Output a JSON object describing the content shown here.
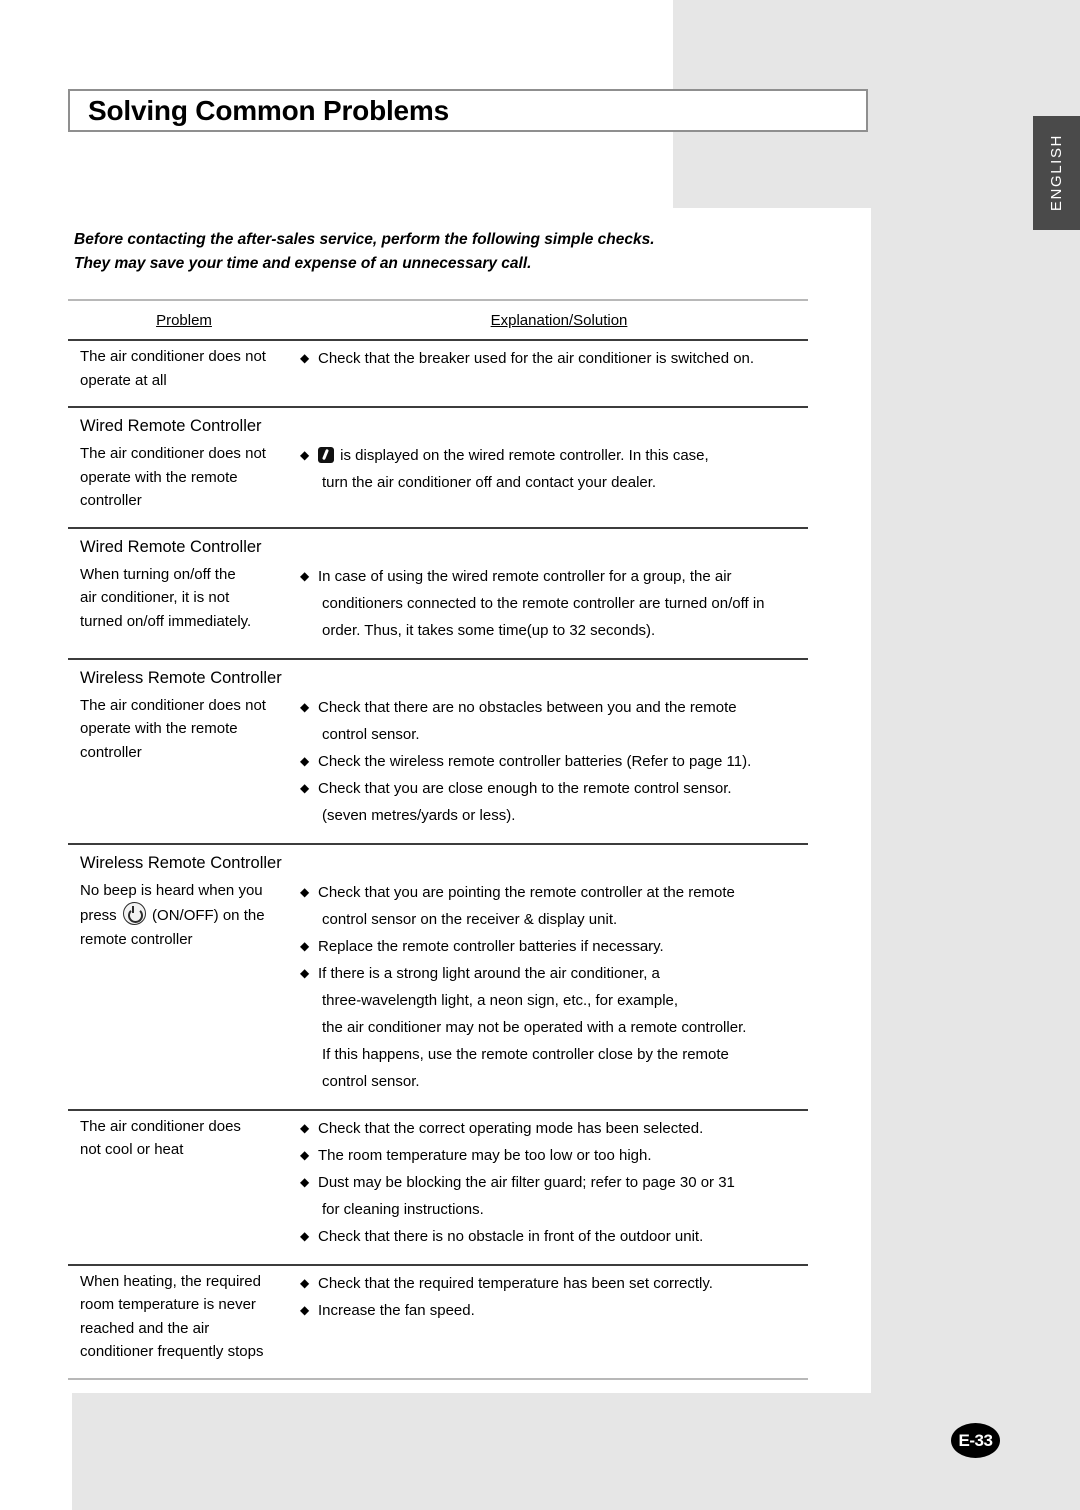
{
  "page": {
    "title": "Solving Common Problems",
    "language_tab": "ENGLISH",
    "page_number": "E-33",
    "intro_line1": "Before contacting the after-sales service, perform the following simple checks.",
    "intro_line2": "They may save your time and expense of an unnecessary call."
  },
  "table": {
    "headers": {
      "problem": "Problem",
      "solution": "Explanation/Solution"
    },
    "sections": [
      {
        "group_label": null,
        "problem_lines": [
          "The air conditioner does not",
          "operate at all"
        ],
        "solutions": [
          {
            "icon": null,
            "lines": [
              "Check that the breaker used for the air conditioner is switched on."
            ]
          }
        ]
      },
      {
        "group_label": "Wired Remote Controller",
        "problem_lines": [
          "The air conditioner does not",
          "operate with the remote",
          "controller"
        ],
        "solutions": [
          {
            "icon": "display-error-icon",
            "lines": [
              "is displayed on the wired remote controller. In this case,",
              "turn the air conditioner off and contact your dealer."
            ]
          }
        ]
      },
      {
        "group_label": "Wired Remote Controller",
        "problem_lines": [
          "When turning on/off the",
          "air conditioner, it is not",
          "turned on/off immediately."
        ],
        "solutions": [
          {
            "icon": null,
            "lines": [
              "In case of using the wired remote controller for a group, the air",
              "conditioners connected to the remote controller are turned on/off in",
              "order. Thus, it takes some time(up to 32 seconds)."
            ]
          }
        ]
      },
      {
        "group_label": "Wireless Remote Controller",
        "problem_lines": [
          "The air conditioner does not",
          "operate with the remote",
          "controller"
        ],
        "solutions": [
          {
            "icon": null,
            "lines": [
              "Check that there are no obstacles between you and the remote",
              "control sensor."
            ]
          },
          {
            "icon": null,
            "lines": [
              "Check the wireless remote controller batteries (Refer to page 11)."
            ]
          },
          {
            "icon": null,
            "lines": [
              "Check that you are close enough to the remote control sensor.",
              "(seven metres/yards or less)."
            ]
          }
        ]
      },
      {
        "group_label": "Wireless Remote Controller",
        "problem_lines_rich": {
          "before": "No beep is heard when you",
          "press_prefix": "press",
          "press_suffix": "(ON/OFF) on the",
          "after": "remote controller"
        },
        "solutions": [
          {
            "icon": null,
            "lines": [
              "Check that you are pointing the remote controller at the remote",
              "control sensor on the receiver & display unit."
            ]
          },
          {
            "icon": null,
            "lines": [
              "Replace the remote controller batteries if necessary."
            ]
          },
          {
            "icon": null,
            "lines": [
              "If there is a strong light around the air conditioner, a",
              "three-wavelength light, a neon sign, etc., for example,",
              "the air conditioner may not be operated with a remote controller.",
              "If this happens, use the remote controller close by the remote",
              "control sensor."
            ]
          }
        ]
      },
      {
        "group_label": null,
        "problem_lines": [
          "The air conditioner does",
          "not cool or heat"
        ],
        "solutions": [
          {
            "icon": null,
            "lines": [
              "Check that the correct operating mode has been selected."
            ]
          },
          {
            "icon": null,
            "lines": [
              "The room temperature may be too low or too high."
            ]
          },
          {
            "icon": null,
            "lines": [
              "Dust may be blocking the air filter guard; refer to page 30 or 31",
              "for cleaning instructions."
            ]
          },
          {
            "icon": null,
            "lines": [
              "Check that there is no obstacle in front of the outdoor unit."
            ]
          }
        ]
      },
      {
        "group_label": null,
        "problem_lines": [
          "When heating, the required",
          "room temperature is never",
          "reached and the air",
          "conditioner frequently stops"
        ],
        "solutions": [
          {
            "icon": null,
            "lines": [
              "Check that the required temperature has been set correctly."
            ]
          },
          {
            "icon": null,
            "lines": [
              "Increase the fan speed."
            ]
          }
        ]
      }
    ],
    "bullet_glyph": "◆"
  },
  "colors": {
    "grey_plate": "#e6e6e6",
    "tab_dark": "#4a4a4a",
    "rule_light": "#b8b8b8",
    "rule_dark": "#3c3c3c",
    "badge": "#000000"
  }
}
